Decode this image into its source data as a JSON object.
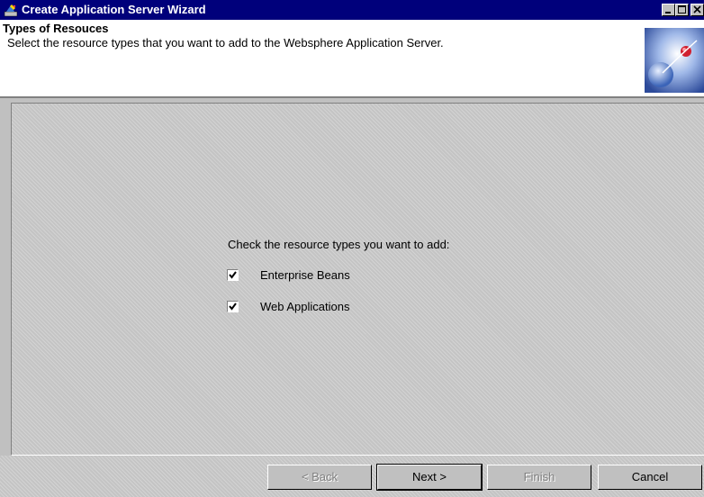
{
  "window": {
    "title": "Create Application Server Wizard",
    "controls": {
      "minimize_icon": "minimize-icon",
      "maximize_icon": "maximize-icon",
      "close_icon": "close-icon"
    }
  },
  "header": {
    "title": "Types of Resouces",
    "description": "Select the resource types that you want to add to the Websphere Application Server."
  },
  "content": {
    "prompt": "Check the resource types you want to add:",
    "options": [
      {
        "label": "Enterprise Beans",
        "checked": true
      },
      {
        "label": "Web Applications",
        "checked": true
      }
    ]
  },
  "buttons": {
    "back": {
      "label": "< Back",
      "enabled": false
    },
    "next": {
      "label": "Next >",
      "enabled": true
    },
    "finish": {
      "label": "Finish",
      "enabled": false
    },
    "cancel": {
      "label": "Cancel",
      "enabled": true
    }
  },
  "colors": {
    "titlebar": "#00007b",
    "face": "#c0c0c0",
    "header_bg": "#ffffff"
  }
}
